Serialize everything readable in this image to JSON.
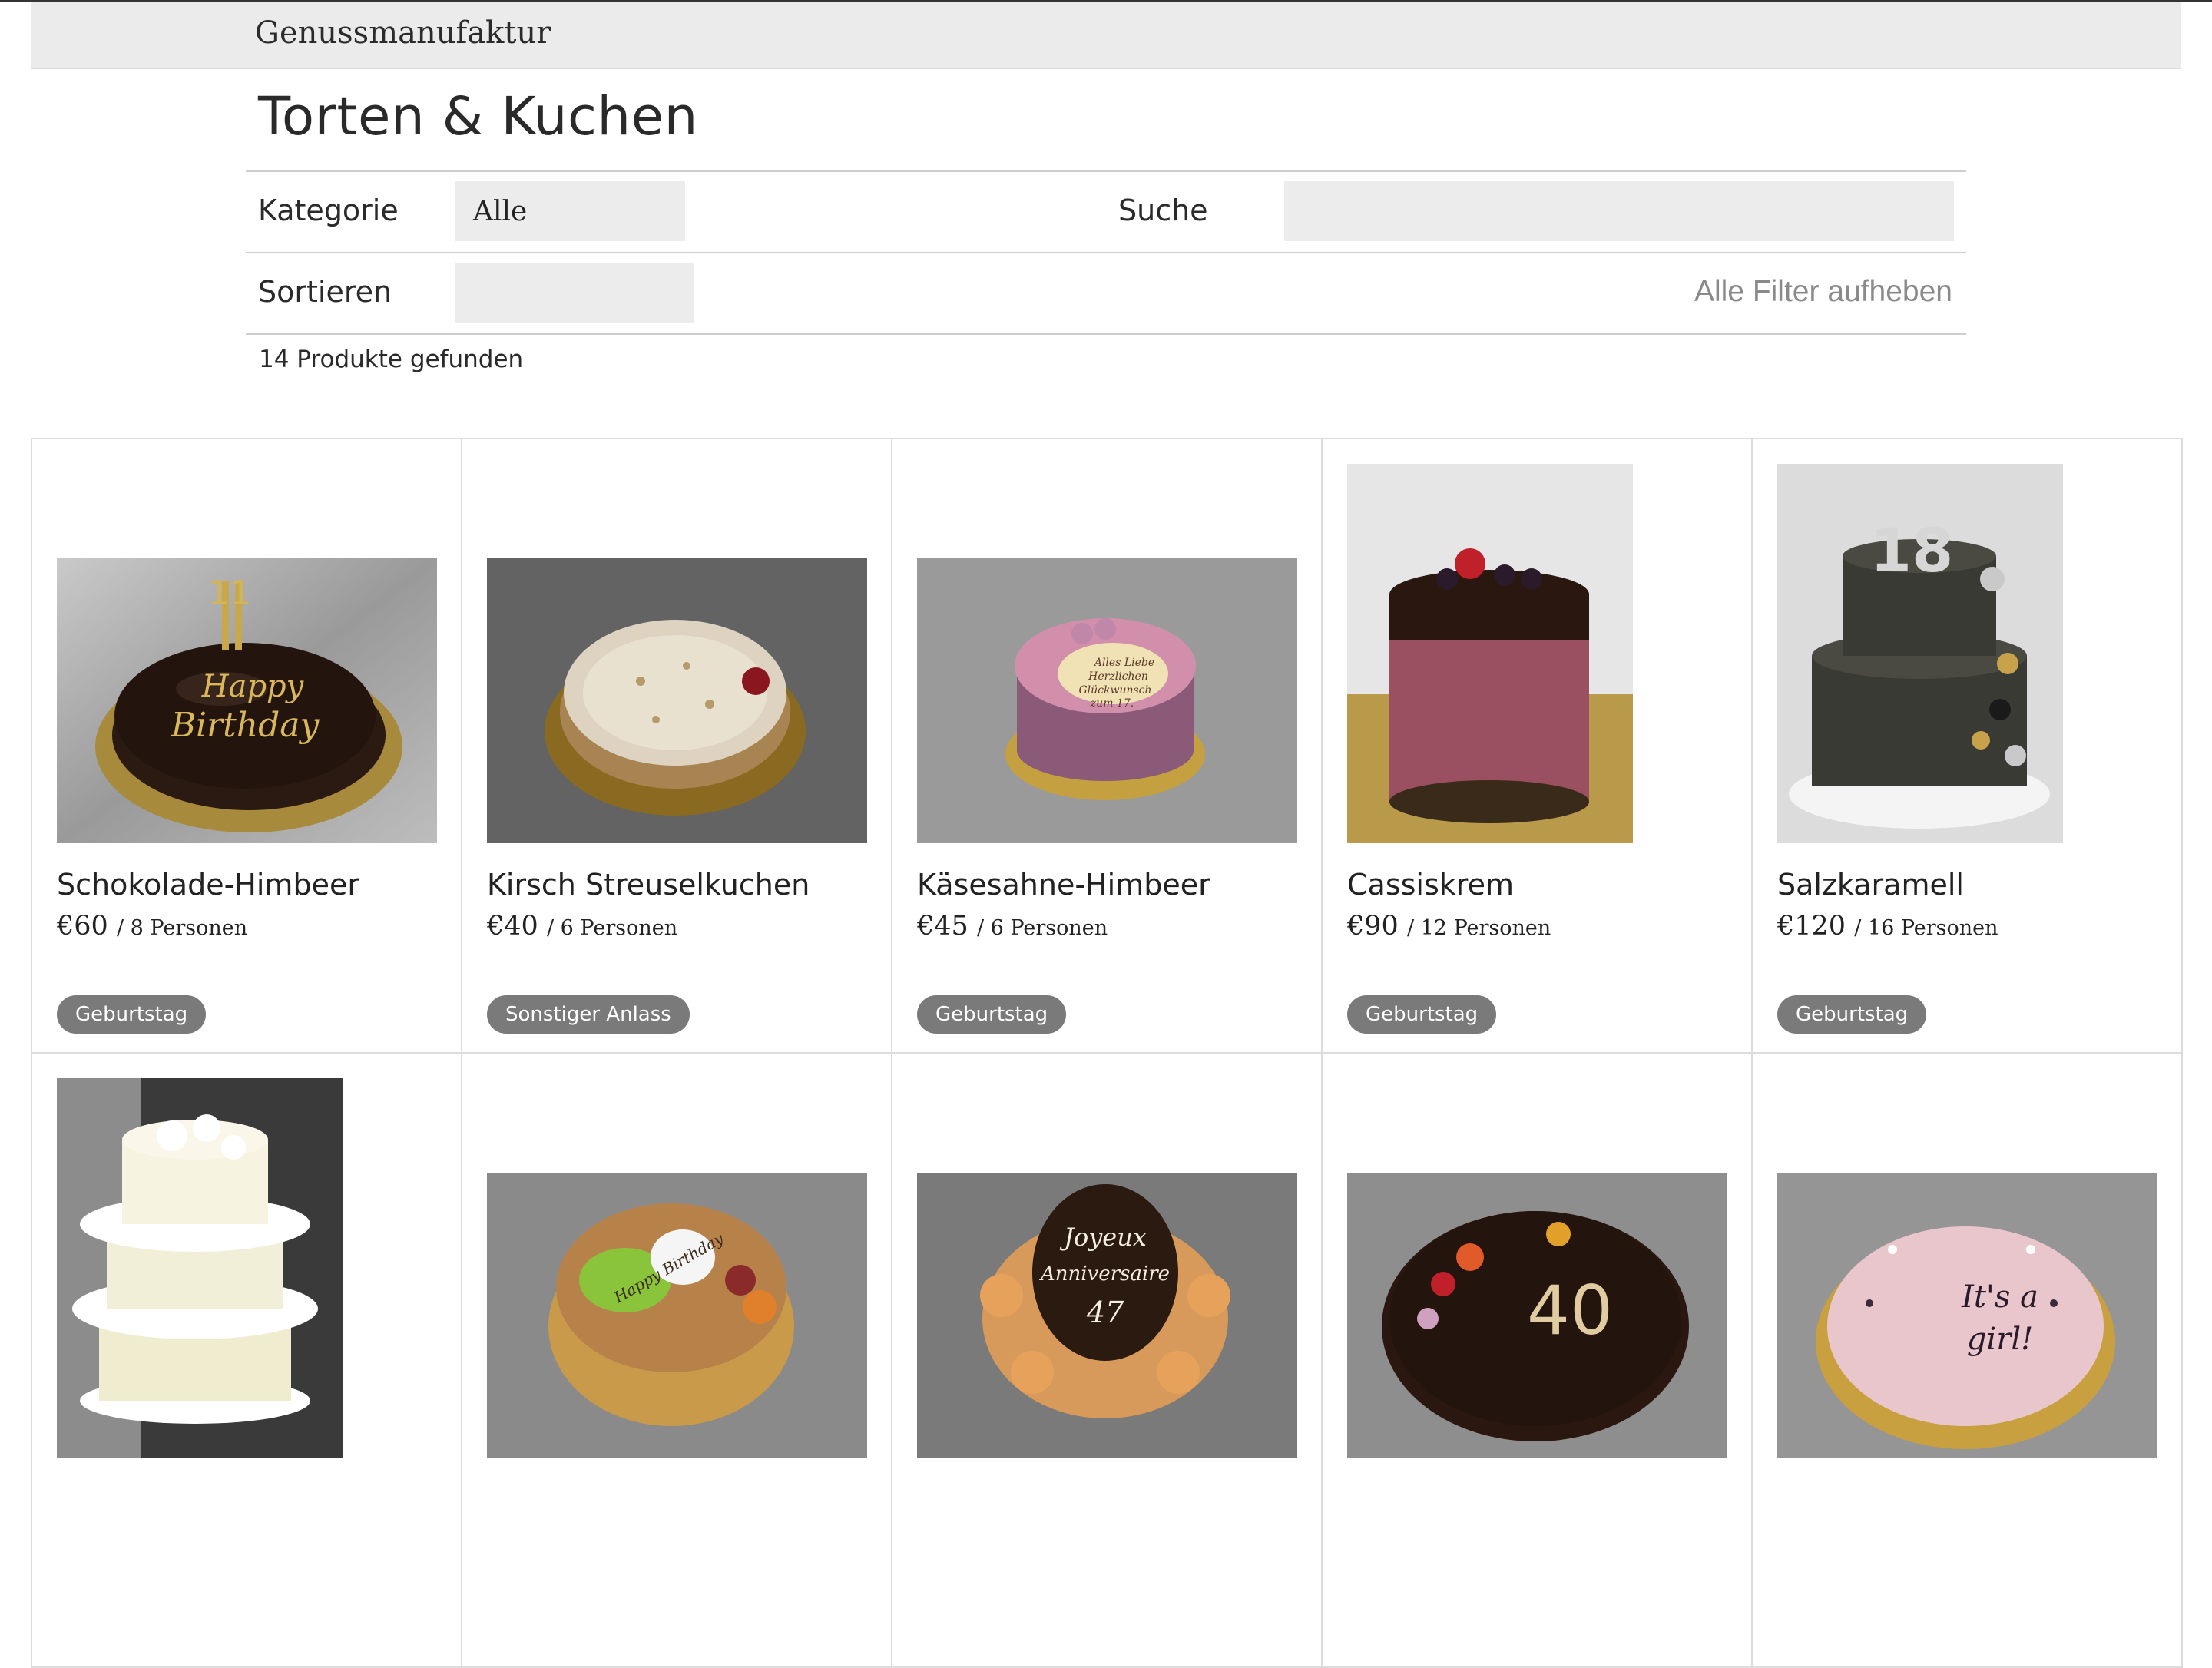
{
  "header": {
    "brand": "Genussmanufaktur"
  },
  "page": {
    "title": "Torten & Kuchen"
  },
  "filters": {
    "category_label": "Kategorie",
    "category_value": "Alle",
    "search_label": "Suche",
    "search_value": "",
    "sort_label": "Sortieren",
    "sort_value": "",
    "reset_label": "Alle Filter aufheben"
  },
  "results": {
    "count_text": "14 Produkte gefunden"
  },
  "products": [
    {
      "name": "Schokolade-Himbeer",
      "price": "€60",
      "per": "/ 8 Personen",
      "tag": "Geburtstag"
    },
    {
      "name": "Kirsch Streuselkuchen",
      "price": "€40",
      "per": "/ 6 Personen",
      "tag": "Sonstiger Anlass"
    },
    {
      "name": "Käsesahne-Himbeer",
      "price": "€45",
      "per": "/ 6 Personen",
      "tag": "Geburtstag"
    },
    {
      "name": "Cassiskrem",
      "price": "€90",
      "per": "/ 12 Personen",
      "tag": "Geburtstag"
    },
    {
      "name": "Salzkaramell",
      "price": "€120",
      "per": "/ 16 Personen",
      "tag": "Geburtstag"
    }
  ],
  "photo_texts": {
    "p1": [
      "Happy",
      "Birthday",
      "11"
    ],
    "p3": [
      "Alles Liebe",
      "Herzlichen",
      "Glückwunsch",
      "zum 17."
    ],
    "p5": "18",
    "r2": "Happy Birthday",
    "r3": [
      "Joyeux",
      "Anniversaire",
      "47"
    ],
    "r4": "40",
    "r5": [
      "It's a",
      "girl!"
    ]
  },
  "colors": {
    "badge": "#7a7a7a",
    "topbar": "#ebebeb",
    "input_bg": "#ececec"
  }
}
